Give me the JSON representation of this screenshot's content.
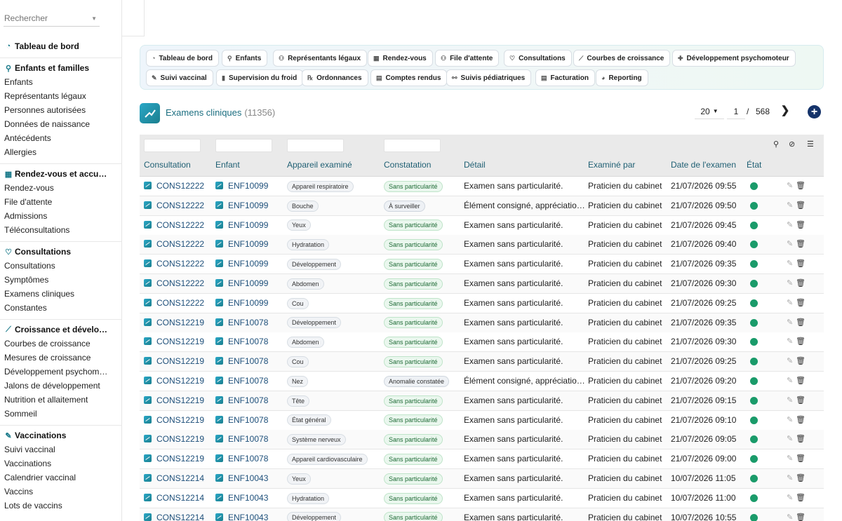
{
  "search": {
    "placeholder": "Rechercher"
  },
  "sidebar": {
    "dashboard": "Tableau de bord",
    "sections": [
      {
        "title": "Enfants et familles",
        "icon": "child-icon",
        "glyph": "⚲",
        "items": [
          "Enfants",
          "Représentants légaux",
          "Personnes autorisées",
          "Données de naissance",
          "Antécédents",
          "Allergies"
        ]
      },
      {
        "title": "Rendez-vous et accu…",
        "icon": "calendar-icon",
        "glyph": "▦",
        "items": [
          "Rendez-vous",
          "File d'attente",
          "Admissions",
          "Téléconsultations"
        ]
      },
      {
        "title": "Consultations",
        "icon": "stethoscope-icon",
        "glyph": "♡",
        "items": [
          "Consultations",
          "Symptômes",
          "Examens cliniques",
          "Constantes"
        ]
      },
      {
        "title": "Croissance et dévelo…",
        "icon": "chart-icon",
        "glyph": "⟋",
        "items": [
          "Courbes de croissance",
          "Mesures de croissance",
          "Développement psychom…",
          "Jalons de développement",
          "Nutrition et allaitement",
          "Sommeil"
        ]
      },
      {
        "title": "Vaccinations",
        "icon": "syringe-icon",
        "glyph": "✎",
        "items": [
          "Suivi vaccinal",
          "Vaccinations",
          "Calendrier vaccinal",
          "Vaccins",
          "Lots de vaccins"
        ]
      }
    ]
  },
  "modules": [
    {
      "label": "Tableau de bord",
      "icon": "dashboard-icon",
      "glyph": "◔"
    },
    {
      "label": "Enfants",
      "icon": "child-icon",
      "glyph": "⚲"
    },
    {
      "label": "Représentants légaux",
      "icon": "users-icon",
      "glyph": "⚇"
    },
    {
      "label": "Rendez-vous",
      "icon": "calendar-icon",
      "glyph": "▦"
    },
    {
      "label": "File d'attente",
      "icon": "queue-icon",
      "glyph": "⚇"
    },
    {
      "label": "Consultations",
      "icon": "stethoscope-icon",
      "glyph": "♡"
    },
    {
      "label": "Courbes de croissance",
      "icon": "chart-icon",
      "glyph": "⟋"
    },
    {
      "label": "Développement psychomoteur",
      "icon": "puzzle-icon",
      "glyph": "✚"
    },
    {
      "label": "Suivi vaccinal",
      "icon": "syringe-icon",
      "glyph": "✎"
    },
    {
      "label": "Supervision du froid",
      "icon": "thermometer-icon",
      "glyph": "▮"
    },
    {
      "label": "Ordonnances",
      "icon": "prescription-icon",
      "glyph": "℞"
    },
    {
      "label": "Comptes rendus",
      "icon": "file-icon",
      "glyph": "▤"
    },
    {
      "label": "Suivis pédiatriques",
      "icon": "network-icon",
      "glyph": "⚯"
    },
    {
      "label": "Facturation",
      "icon": "invoice-icon",
      "glyph": "▤"
    },
    {
      "label": "Reporting",
      "icon": "pie-icon",
      "glyph": "◕"
    }
  ],
  "page": {
    "title": "Examens cliniques",
    "count": "(11356)"
  },
  "pager": {
    "page_size": "20",
    "current": "1",
    "separator": "/",
    "total": "568"
  },
  "columns": [
    "Consultation",
    "Enfant",
    "Appareil examiné",
    "Constatation",
    "Détail",
    "Examiné par",
    "Date de l'examen",
    "État"
  ],
  "rows": [
    {
      "consultation": "CONS12222",
      "enfant": "ENF10099",
      "appareil": "Appareil respiratoire",
      "constatation": "Sans particularité",
      "status": "ok",
      "detail": "Examen sans particularité.",
      "examine_par": "Praticien du cabinet",
      "date": "21/07/2026 09:55"
    },
    {
      "consultation": "CONS12222",
      "enfant": "ENF10099",
      "appareil": "Bouche",
      "constatation": "À surveiller",
      "status": "warn",
      "detail": "Élément consigné, appréciatio…",
      "examine_par": "Praticien du cabinet",
      "date": "21/07/2026 09:50"
    },
    {
      "consultation": "CONS12222",
      "enfant": "ENF10099",
      "appareil": "Yeux",
      "constatation": "Sans particularité",
      "status": "ok",
      "detail": "Examen sans particularité.",
      "examine_par": "Praticien du cabinet",
      "date": "21/07/2026 09:45"
    },
    {
      "consultation": "CONS12222",
      "enfant": "ENF10099",
      "appareil": "Hydratation",
      "constatation": "Sans particularité",
      "status": "ok",
      "detail": "Examen sans particularité.",
      "examine_par": "Praticien du cabinet",
      "date": "21/07/2026 09:40"
    },
    {
      "consultation": "CONS12222",
      "enfant": "ENF10099",
      "appareil": "Développement",
      "constatation": "Sans particularité",
      "status": "ok",
      "detail": "Examen sans particularité.",
      "examine_par": "Praticien du cabinet",
      "date": "21/07/2026 09:35"
    },
    {
      "consultation": "CONS12222",
      "enfant": "ENF10099",
      "appareil": "Abdomen",
      "constatation": "Sans particularité",
      "status": "ok",
      "detail": "Examen sans particularité.",
      "examine_par": "Praticien du cabinet",
      "date": "21/07/2026 09:30"
    },
    {
      "consultation": "CONS12222",
      "enfant": "ENF10099",
      "appareil": "Cou",
      "constatation": "Sans particularité",
      "status": "ok",
      "detail": "Examen sans particularité.",
      "examine_par": "Praticien du cabinet",
      "date": "21/07/2026 09:25"
    },
    {
      "consultation": "CONS12219",
      "enfant": "ENF10078",
      "appareil": "Développement",
      "constatation": "Sans particularité",
      "status": "ok",
      "detail": "Examen sans particularité.",
      "examine_par": "Praticien du cabinet",
      "date": "21/07/2026 09:35"
    },
    {
      "consultation": "CONS12219",
      "enfant": "ENF10078",
      "appareil": "Abdomen",
      "constatation": "Sans particularité",
      "status": "ok",
      "detail": "Examen sans particularité.",
      "examine_par": "Praticien du cabinet",
      "date": "21/07/2026 09:30"
    },
    {
      "consultation": "CONS12219",
      "enfant": "ENF10078",
      "appareil": "Cou",
      "constatation": "Sans particularité",
      "status": "ok",
      "detail": "Examen sans particularité.",
      "examine_par": "Praticien du cabinet",
      "date": "21/07/2026 09:25"
    },
    {
      "consultation": "CONS12219",
      "enfant": "ENF10078",
      "appareil": "Nez",
      "constatation": "Anomalie constatée",
      "status": "bad",
      "detail": "Élément consigné, appréciatio…",
      "examine_par": "Praticien du cabinet",
      "date": "21/07/2026 09:20"
    },
    {
      "consultation": "CONS12219",
      "enfant": "ENF10078",
      "appareil": "Tête",
      "constatation": "Sans particularité",
      "status": "ok",
      "detail": "Examen sans particularité.",
      "examine_par": "Praticien du cabinet",
      "date": "21/07/2026 09:15"
    },
    {
      "consultation": "CONS12219",
      "enfant": "ENF10078",
      "appareil": "État général",
      "constatation": "Sans particularité",
      "status": "ok",
      "detail": "Examen sans particularité.",
      "examine_par": "Praticien du cabinet",
      "date": "21/07/2026 09:10"
    },
    {
      "consultation": "CONS12219",
      "enfant": "ENF10078",
      "appareil": "Système nerveux",
      "constatation": "Sans particularité",
      "status": "ok",
      "detail": "Examen sans particularité.",
      "examine_par": "Praticien du cabinet",
      "date": "21/07/2026 09:05"
    },
    {
      "consultation": "CONS12219",
      "enfant": "ENF10078",
      "appareil": "Appareil cardiovasculaire",
      "constatation": "Sans particularité",
      "status": "ok",
      "detail": "Examen sans particularité.",
      "examine_par": "Praticien du cabinet",
      "date": "21/07/2026 09:00"
    },
    {
      "consultation": "CONS12214",
      "enfant": "ENF10043",
      "appareil": "Yeux",
      "constatation": "Sans particularité",
      "status": "ok",
      "detail": "Examen sans particularité.",
      "examine_par": "Praticien du cabinet",
      "date": "10/07/2026 11:05"
    },
    {
      "consultation": "CONS12214",
      "enfant": "ENF10043",
      "appareil": "Hydratation",
      "constatation": "Sans particularité",
      "status": "ok",
      "detail": "Examen sans particularité.",
      "examine_par": "Praticien du cabinet",
      "date": "10/07/2026 11:00"
    },
    {
      "consultation": "CONS12214",
      "enfant": "ENF10043",
      "appareil": "Développement",
      "constatation": "Sans particularité",
      "status": "ok",
      "detail": "Examen sans particularité.",
      "examine_par": "Praticien du cabinet",
      "date": "10/07/2026 10:55"
    }
  ],
  "colors": {
    "accent": "#1b7f8e",
    "link": "#1d4f7a",
    "status_ok": "#1a9b6a",
    "add_button": "#15336a"
  }
}
